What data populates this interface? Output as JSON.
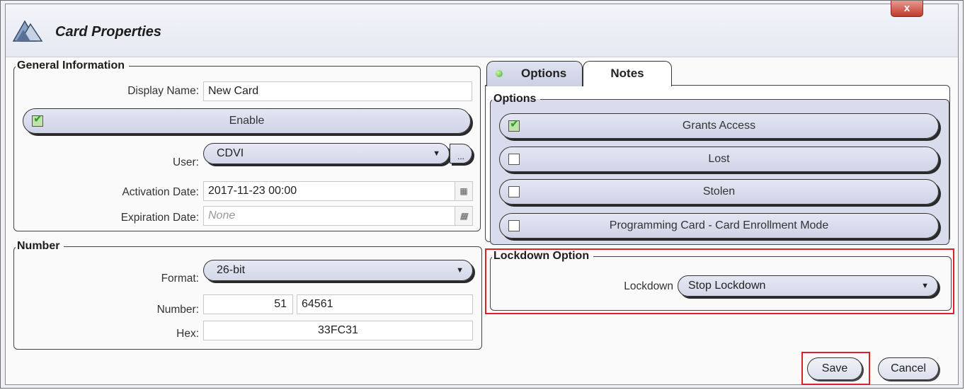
{
  "window": {
    "title": "Card Properties",
    "close_label": "x"
  },
  "general": {
    "legend": "General Information",
    "display_name_label": "Display Name:",
    "display_name_value": "New Card",
    "enable_label": "Enable",
    "enable_checked": true,
    "user_label": "User:",
    "user_value": "CDVI",
    "user_browse_label": "...",
    "activation_label": "Activation Date:",
    "activation_value": "2017-11-23 00:00",
    "expiration_label": "Expiration Date:",
    "expiration_placeholder": "None"
  },
  "number": {
    "legend": "Number",
    "format_label": "Format:",
    "format_value": "26-bit",
    "number_label": "Number:",
    "facility_value": "51",
    "card_value": "64561",
    "hex_label": "Hex:",
    "hex_value": "33FC31"
  },
  "tabs": [
    {
      "label": "Options",
      "active": true
    },
    {
      "label": "Notes",
      "active": false
    }
  ],
  "options": {
    "legend": "Options",
    "items": [
      {
        "label": "Grants Access",
        "checked": true
      },
      {
        "label": "Lost",
        "checked": false
      },
      {
        "label": "Stolen",
        "checked": false
      },
      {
        "label": "Programming Card - Card Enrollment Mode",
        "checked": false
      }
    ]
  },
  "lockdown": {
    "legend": "Lockdown Option",
    "label": "Lockdown",
    "value": "Stop Lockdown"
  },
  "footer": {
    "save_label": "Save",
    "cancel_label": "Cancel"
  },
  "colors": {
    "highlight": "#d9232a",
    "accent": "#3fae2a"
  }
}
